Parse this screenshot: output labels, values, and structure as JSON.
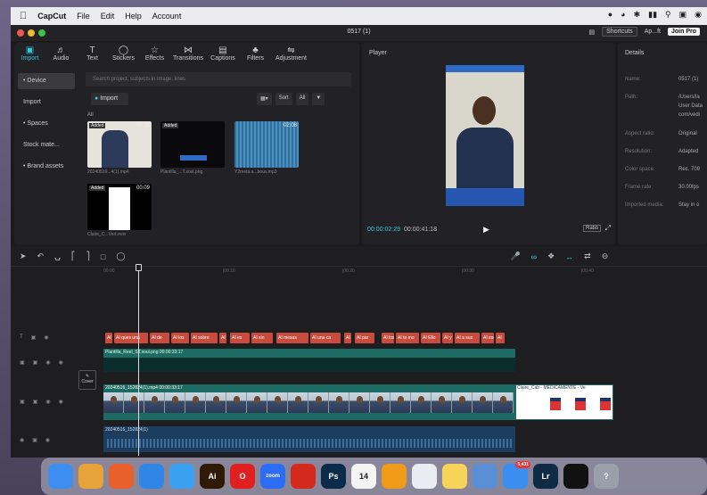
{
  "menubar": {
    "app": "CapCut",
    "items": [
      "File",
      "Edit",
      "Help",
      "Account"
    ]
  },
  "window": {
    "title": "0517 (1)",
    "shortcuts": "Shortcuts",
    "account": "Ap...ft",
    "join": "Join Pro"
  },
  "tools": [
    {
      "label": "Import",
      "icon": "import-icon"
    },
    {
      "label": "Audio",
      "icon": "audio-icon"
    },
    {
      "label": "Text",
      "icon": "text-icon"
    },
    {
      "label": "Stickers",
      "icon": "stickers-icon"
    },
    {
      "label": "Effects",
      "icon": "effects-icon"
    },
    {
      "label": "Transitions",
      "icon": "transitions-icon"
    },
    {
      "label": "Captions",
      "icon": "captions-icon"
    },
    {
      "label": "Filters",
      "icon": "filters-icon"
    },
    {
      "label": "Adjustment",
      "icon": "adjustment-icon"
    }
  ],
  "sidenav": [
    "• Device",
    "Import",
    "• Spaces",
    "Stock mate...",
    "• Brand assets"
  ],
  "media": {
    "search_placeholder": "Search project, subjects in image, lines",
    "import": "Import",
    "sort": "Sort",
    "all_btn": "All",
    "all_label": "All",
    "clips": [
      {
        "badge": "Added",
        "dur": "00:35",
        "name": "20240516...4(1).mp4"
      },
      {
        "badge": "Added",
        "dur": "",
        "name": "Plantilla_...T.soul.png"
      },
      {
        "badge": "",
        "dur": "02:08",
        "name": "Y2meta.a...bous.mp3"
      },
      {
        "badge": "Added",
        "dur": "00:09",
        "name": "Claire_C...Vert.mov"
      }
    ]
  },
  "player": {
    "label": "Player",
    "current": "00:00:02:29",
    "total": "00:00:41:18",
    "ratio": "Ratio"
  },
  "details": {
    "title": "Details",
    "rows": [
      {
        "k": "Name:",
        "v": "0517 (1)"
      },
      {
        "k": "Path:",
        "v": "/Users/la"
      },
      {
        "k": "",
        "v": "User Data"
      },
      {
        "k": "",
        "v": "com/vedi"
      },
      {
        "k": "Aspect ratio:",
        "v": "Original"
      },
      {
        "k": "Resolution:",
        "v": "Adapted"
      },
      {
        "k": "Color space:",
        "v": "Rec. 709"
      },
      {
        "k": "Frame rate:",
        "v": "30.00fps"
      },
      {
        "k": "Imported media:",
        "v": "Stay in o"
      }
    ]
  },
  "ruler": [
    "00:00",
    "|00:10",
    "|00:20",
    "|00:30",
    "|00:40"
  ],
  "ai_chips": [
    "AI",
    "AI ques una",
    "AI de",
    "AI los",
    "AI sobre",
    "AI",
    "AI es",
    "AI sin",
    "AI mesas",
    "AI una ca",
    "AI",
    "AI par",
    "AI los",
    "AI te mo",
    "AI Ello",
    "AI y",
    "AI a sus",
    "AI ese",
    "AI"
  ],
  "tracks": {
    "image": "Plantilla_Reel_ST.soul.png  00:00:33:17",
    "main": "20240516_152824(1).mp4  00:00:33:17",
    "second": "Claire_Cab - MEDICAMENTE - Ve",
    "audio": "20240516_152824(1)",
    "cover": "Cover"
  },
  "dock": [
    {
      "icon": "finder-icon",
      "label": "",
      "color": "#3d8ef0"
    },
    {
      "icon": "launchpad-icon",
      "label": "",
      "color": "#e8a23a"
    },
    {
      "icon": "firefox-icon",
      "label": "",
      "color": "#e8602c"
    },
    {
      "icon": "keynote-icon",
      "label": "",
      "color": "#2f86e6"
    },
    {
      "icon": "safari-icon",
      "label": "",
      "color": "#3aa0f0"
    },
    {
      "icon": "illustrator-icon",
      "label": "Ai",
      "color": "#2e1a05"
    },
    {
      "icon": "opera-icon",
      "label": "O",
      "color": "#e02020"
    },
    {
      "icon": "zoom-icon",
      "label": "zoom",
      "color": "#2d6df6"
    },
    {
      "icon": "acrobat-icon",
      "label": "",
      "color": "#d42a1e"
    },
    {
      "icon": "photoshop-icon",
      "label": "Ps",
      "color": "#0b2b4a"
    },
    {
      "icon": "calendar-icon",
      "label": "14",
      "color": "#f4f4f4"
    },
    {
      "icon": "pages-icon",
      "label": "",
      "color": "#f09a1a"
    },
    {
      "icon": "activity-icon",
      "label": "",
      "color": "#e9ecf2"
    },
    {
      "icon": "notes-icon",
      "label": "",
      "color": "#f6d45a"
    },
    {
      "icon": "preview-icon",
      "label": "",
      "color": "#5a8fd6"
    },
    {
      "icon": "mail-icon",
      "label": "",
      "color": "#3b8ef0",
      "badge": "5,431"
    },
    {
      "icon": "lightroom-icon",
      "label": "Lr",
      "color": "#0f2a44"
    },
    {
      "icon": "capcut-icon",
      "label": "",
      "color": "#111111"
    },
    {
      "icon": "help-icon",
      "label": "?",
      "color": "#9aa0aa"
    }
  ]
}
